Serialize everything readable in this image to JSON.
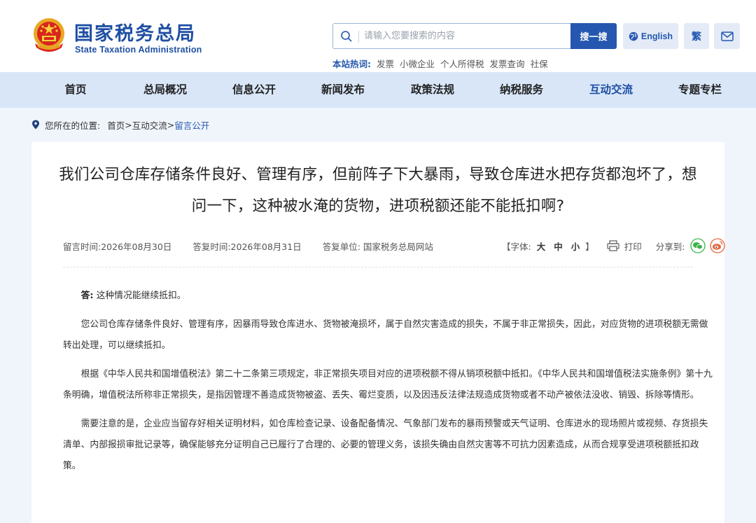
{
  "header": {
    "logo_cn": "国家税务总局",
    "logo_en": "State Taxation Administration",
    "search": {
      "placeholder": "请输入您要搜索的内容",
      "button_label": "搜一搜"
    },
    "lang_label": "English",
    "traditional_label": "繁",
    "hot": {
      "label": "本站热词:",
      "items": [
        "发票",
        "小微企业",
        "个人所得税",
        "发票查询",
        "社保"
      ]
    }
  },
  "nav": {
    "items": [
      "首页",
      "总局概况",
      "信息公开",
      "新闻发布",
      "政策法规",
      "纳税服务",
      "互动交流",
      "专题专栏"
    ],
    "active_index": 6
  },
  "breadcrumb": {
    "label": "您所在的位置:",
    "items": [
      "首页",
      "互动交流",
      "留言公开"
    ],
    "separator": ">"
  },
  "article": {
    "title": "我们公司仓库存储条件良好、管理有序，但前阵子下大暴雨，导致仓库进水把存货都泡坏了，想问一下，这种被水淹的货物，进项税额还能不能抵扣啊?",
    "meta": {
      "message_time": "留言时间:2026年08月30日",
      "reply_time": "答复时间:2026年08月31日",
      "reply_unit": "答复单位: 国家税务总局网站"
    },
    "tools": {
      "font_label_open": "【字体:",
      "font_sizes": [
        "大",
        "中",
        "小"
      ],
      "font_label_close": "】",
      "print_label": "打印",
      "share_label": "分享到:"
    },
    "answer_label": "答:",
    "paragraphs": [
      "这种情况能继续抵扣。",
      "您公司仓库存储条件良好、管理有序，因暴雨导致仓库进水、货物被淹损坏，属于自然灾害造成的损失，不属于非正常损失，因此，对应货物的进项税额无需做转出处理，可以继续抵扣。",
      "根据《中华人民共和国增值税法》第二十二条第三项规定，非正常损失项目对应的进项税额不得从销项税额中抵扣。《中华人民共和国增值税法实施条例》第十九条明确，增值税法所称非正常损失，是指因管理不善造成货物被盗、丢失、霉烂变质，以及因违反法律法规造成货物或者不动产被依法没收、销毁、拆除等情形。",
      "需要注意的是，企业应当留存好相关证明材料，如仓库检查记录、设备配备情况、气象部门发布的暴雨预警或天气证明、仓库进水的现场照片或视频、存货损失清单、内部报损审批记录等，确保能够充分证明自己已履行了合理的、必要的管理义务，该损失确由自然灾害等不可抗力因素造成，从而合规享受进项税额抵扣政策。"
    ]
  },
  "colors": {
    "brand_blue": "#1f4fa3",
    "button_blue": "#2557b0",
    "nav_bg": "#d8e6f8",
    "page_bg": "#f0f5fc",
    "wechat_green": "#3ab54a",
    "weibo_orange": "#e8643c"
  }
}
